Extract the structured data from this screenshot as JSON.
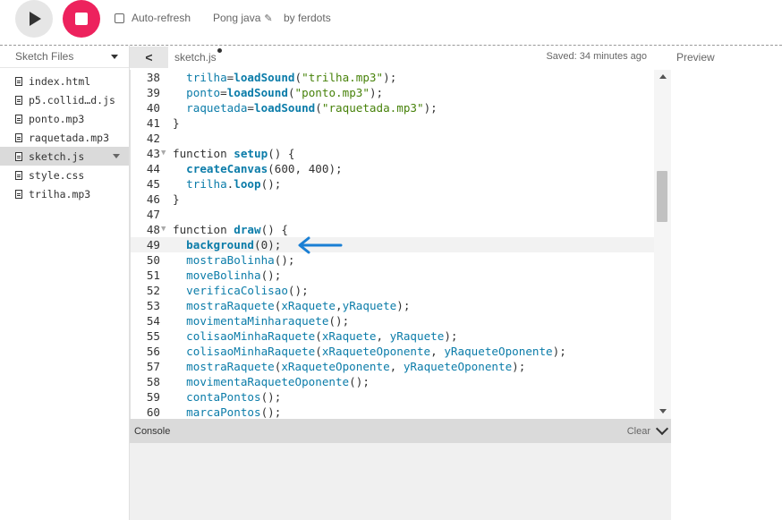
{
  "toolbar": {
    "auto_refresh_label": "Auto-refresh",
    "project_name": "Pong java",
    "by_text": "by ferdots"
  },
  "sidebar": {
    "title": "Sketch Files",
    "files": [
      {
        "name": "index.html"
      },
      {
        "name": "p5.collid…d.js"
      },
      {
        "name": "ponto.mp3"
      },
      {
        "name": "raquetada.mp3"
      },
      {
        "name": "sketch.js",
        "active": true
      },
      {
        "name": "style.css"
      },
      {
        "name": "trilha.mp3"
      }
    ]
  },
  "editor": {
    "tab_name": "sketch.js",
    "saved_status": "Saved: 34 minutes ago",
    "preview_label": "Preview",
    "current_line": 49,
    "lines": [
      {
        "n": "38",
        "text": "  trilha=loadSound(\"trilha.mp3\");"
      },
      {
        "n": "39",
        "text": "  ponto=loadSound(\"ponto.mp3\");"
      },
      {
        "n": "40",
        "text": "  raquetada=loadSound(\"raquetada.mp3\");"
      },
      {
        "n": "41",
        "text": "}"
      },
      {
        "n": "42",
        "text": ""
      },
      {
        "n": "43",
        "text": "function setup() {",
        "fold": true
      },
      {
        "n": "44",
        "text": "  createCanvas(600, 400);"
      },
      {
        "n": "45",
        "text": "  trilha.loop();"
      },
      {
        "n": "46",
        "text": "}"
      },
      {
        "n": "47",
        "text": ""
      },
      {
        "n": "48",
        "text": "function draw() {",
        "fold": true
      },
      {
        "n": "49",
        "text": "  background(0);"
      },
      {
        "n": "50",
        "text": "  mostraBolinha();"
      },
      {
        "n": "51",
        "text": "  moveBolinha();"
      },
      {
        "n": "52",
        "text": "  verificaColisao();"
      },
      {
        "n": "53",
        "text": "  mostraRaquete(xRaquete,yRaquete);"
      },
      {
        "n": "54",
        "text": "  movimentaMinharaquete();"
      },
      {
        "n": "55",
        "text": "  colisaoMinhaRaquete(xRaquete, yRaquete);"
      },
      {
        "n": "56",
        "text": "  colisaoMinhaRaquete(xRaqueteOponente, yRaqueteOponente);"
      },
      {
        "n": "57",
        "text": "  mostraRaquete(xRaqueteOponente, yRaqueteOponente);"
      },
      {
        "n": "58",
        "text": "  movimentaRaqueteOponente();"
      },
      {
        "n": "59",
        "text": "  contaPontos();"
      },
      {
        "n": "60",
        "text": "  marcaPontos();"
      }
    ]
  },
  "console": {
    "title": "Console",
    "clear_label": "Clear"
  },
  "colors": {
    "accent": "#ed225d",
    "annotation_arrow": "#1a7fd4",
    "keyword_blue": "#0b7ca9",
    "string_green": "#47820a"
  },
  "icons": {
    "play": "play-icon",
    "stop": "stop-icon",
    "pencil": "pencil-icon",
    "collapse": "chevron-left-icon",
    "file": "file-icon"
  }
}
